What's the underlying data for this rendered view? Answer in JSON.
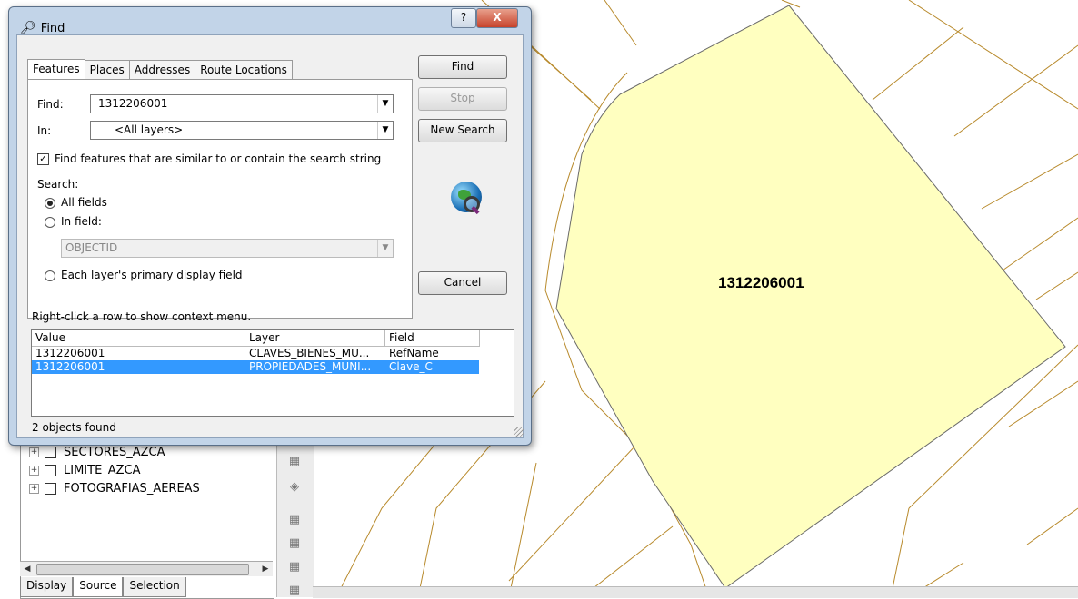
{
  "map": {
    "parcel_label": "1312206001",
    "colors": {
      "parcel_fill": "#ffffc0",
      "parcel_line": "#6a6a6a",
      "boundary_line": "#b88a2c"
    }
  },
  "toc": {
    "layers": [
      {
        "name": "SECTORES_AZCA"
      },
      {
        "name": "LIMITE_AZCA"
      },
      {
        "name": "FOTOGRAFIAS_AEREAS"
      }
    ],
    "tabs": [
      "Display",
      "Source",
      "Selection"
    ]
  },
  "dialog": {
    "title": "Find",
    "help_label": "?",
    "close_label": "X",
    "tabs": [
      "Features",
      "Places",
      "Addresses",
      "Route Locations"
    ],
    "find_label": "Find:",
    "find_value": "1312206001",
    "in_label": "In:",
    "in_value": "<All layers>",
    "similar_checkbox": "Find features that are similar to or contain the search string",
    "search_label": "Search:",
    "radio_all_fields": "All fields",
    "radio_in_field": "In field:",
    "field_value": "OBJECTID",
    "radio_primary": "Each layer's primary display field",
    "buttons": {
      "find": "Find",
      "stop": "Stop",
      "new_search": "New Search",
      "cancel": "Cancel"
    },
    "context_hint": "Right-click a row to show context menu.",
    "results": {
      "columns": [
        "Value",
        "Layer",
        "Field"
      ],
      "rows": [
        {
          "value": "1312206001",
          "layer": "CLAVES_BIENES_MU...",
          "field": "RefName"
        },
        {
          "value": "1312206001",
          "layer": "PROPIEDADES_MUNI...",
          "field": "Clave_C"
        }
      ]
    },
    "status": "2 objects found"
  }
}
